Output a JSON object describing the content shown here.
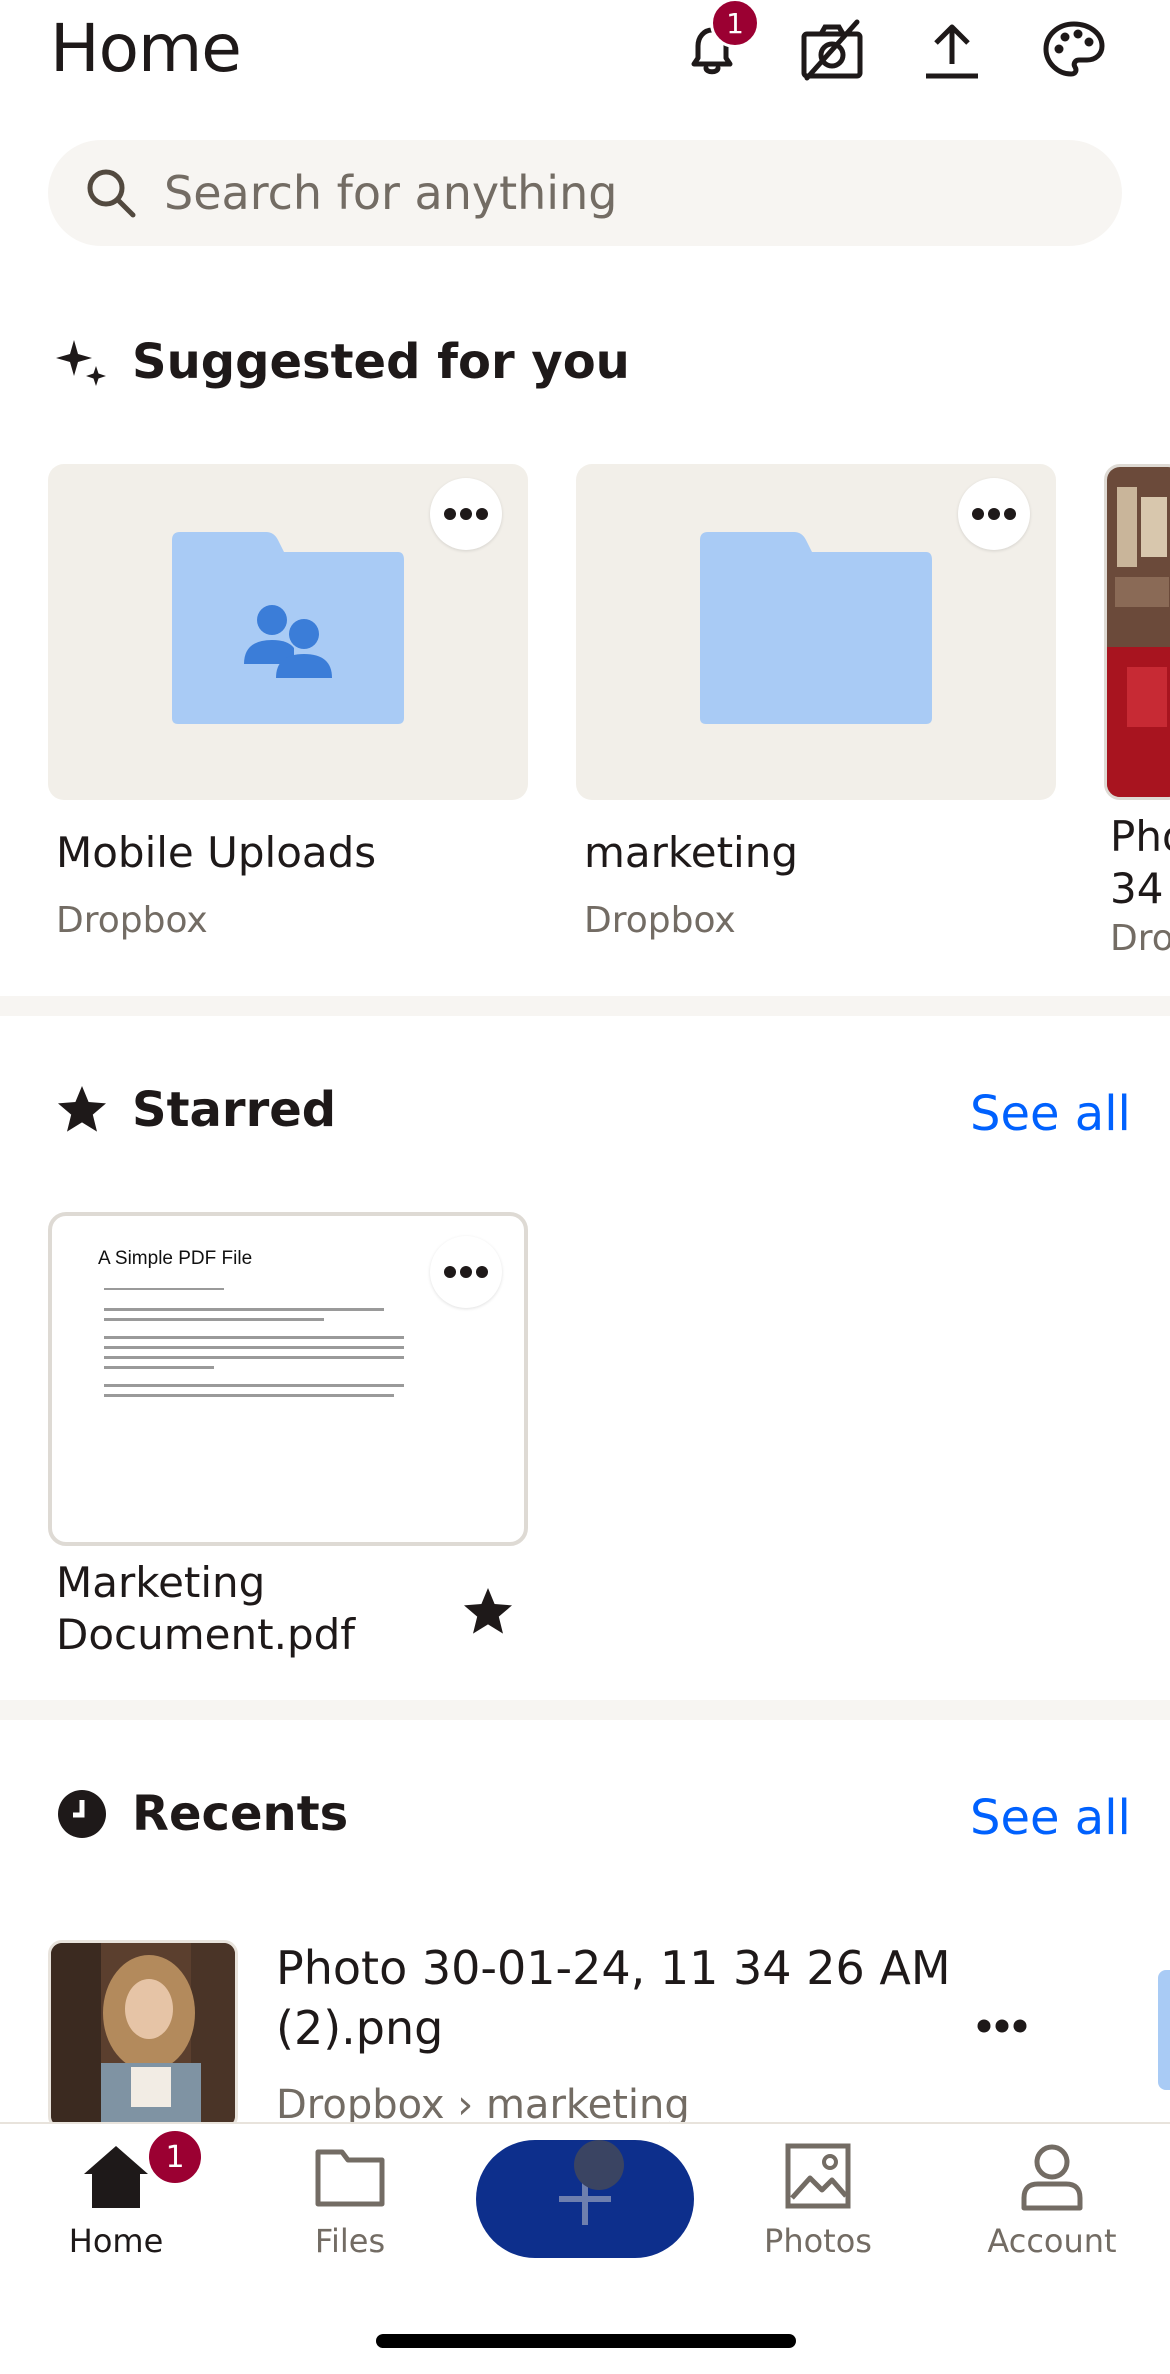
{
  "header": {
    "title": "Home",
    "notification_count": "1"
  },
  "search": {
    "placeholder": "Search for anything"
  },
  "suggested": {
    "title": "Suggested for you",
    "items": [
      {
        "name": "Mobile Uploads",
        "location": "Dropbox",
        "type": "shared-folder"
      },
      {
        "name": "marketing",
        "location": "Dropbox",
        "type": "folder"
      },
      {
        "name": "Pho",
        "name2": "34",
        "location": "Dro",
        "type": "photo"
      }
    ]
  },
  "starred": {
    "title": "Starred",
    "see_all": "See all",
    "items": [
      {
        "name_line1": "Marketing",
        "name_line2": "Document.pdf",
        "preview_title": "A Simple PDF File"
      }
    ]
  },
  "recents": {
    "title": "Recents",
    "see_all": "See all",
    "items": [
      {
        "name": "Photo 30-01-24, 11 34 26 AM (2).png",
        "path": "Dropbox › marketing"
      }
    ]
  },
  "bottom_nav": {
    "home": "Home",
    "home_badge": "1",
    "files": "Files",
    "photos": "Photos",
    "account": "Account"
  },
  "colors": {
    "accent_blue": "#0061fe",
    "fab_blue": "#0d2f8c",
    "badge_red": "#9b0032",
    "folder_blue": "#a9cbf5"
  }
}
